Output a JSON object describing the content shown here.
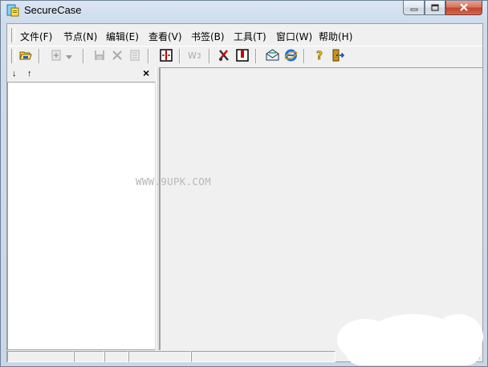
{
  "window": {
    "title": "SecureCase",
    "icons": {
      "app": "securecase-app-icon",
      "minimize": "minimize-icon",
      "maximize": "maximize-icon",
      "close": "close-icon"
    }
  },
  "menu": {
    "items": [
      {
        "label": "文件(F)"
      },
      {
        "label": "节点(N)"
      },
      {
        "label": "编辑(E)"
      },
      {
        "label": "查看(V)"
      },
      {
        "label": "书签(B)"
      },
      {
        "label": "工具(T)"
      },
      {
        "label": "窗口(W)"
      },
      {
        "label": "帮助(H)"
      }
    ]
  },
  "toolbar": {
    "buttons": [
      {
        "icon": "open-folder-icon",
        "enabled": true
      },
      {
        "icon": "add-node-icon",
        "enabled": false
      },
      {
        "icon": "dropdown-arrow-icon",
        "enabled": false
      },
      {
        "icon": "save-icon",
        "enabled": false
      },
      {
        "icon": "delete-icon",
        "enabled": false
      },
      {
        "icon": "properties-icon",
        "enabled": false
      },
      {
        "icon": "split-view-icon",
        "enabled": true
      },
      {
        "icon": "word-wrap-icon",
        "enabled": false
      },
      {
        "icon": "tools-icon",
        "enabled": true
      },
      {
        "icon": "bookmark-icon",
        "enabled": true
      },
      {
        "icon": "email-icon",
        "enabled": true
      },
      {
        "icon": "internet-explorer-icon",
        "enabled": true
      },
      {
        "icon": "help-icon",
        "enabled": true
      },
      {
        "icon": "exit-icon",
        "enabled": true
      }
    ]
  },
  "left_pane": {
    "header_buttons": [
      "↓",
      "↑"
    ],
    "close_symbol": "×"
  },
  "main": {
    "watermark": "WWW.9UPK.COM"
  },
  "colors": {
    "frame": "#c8d7ea",
    "client": "#f0f0f0",
    "close_button": "#c9503a"
  }
}
